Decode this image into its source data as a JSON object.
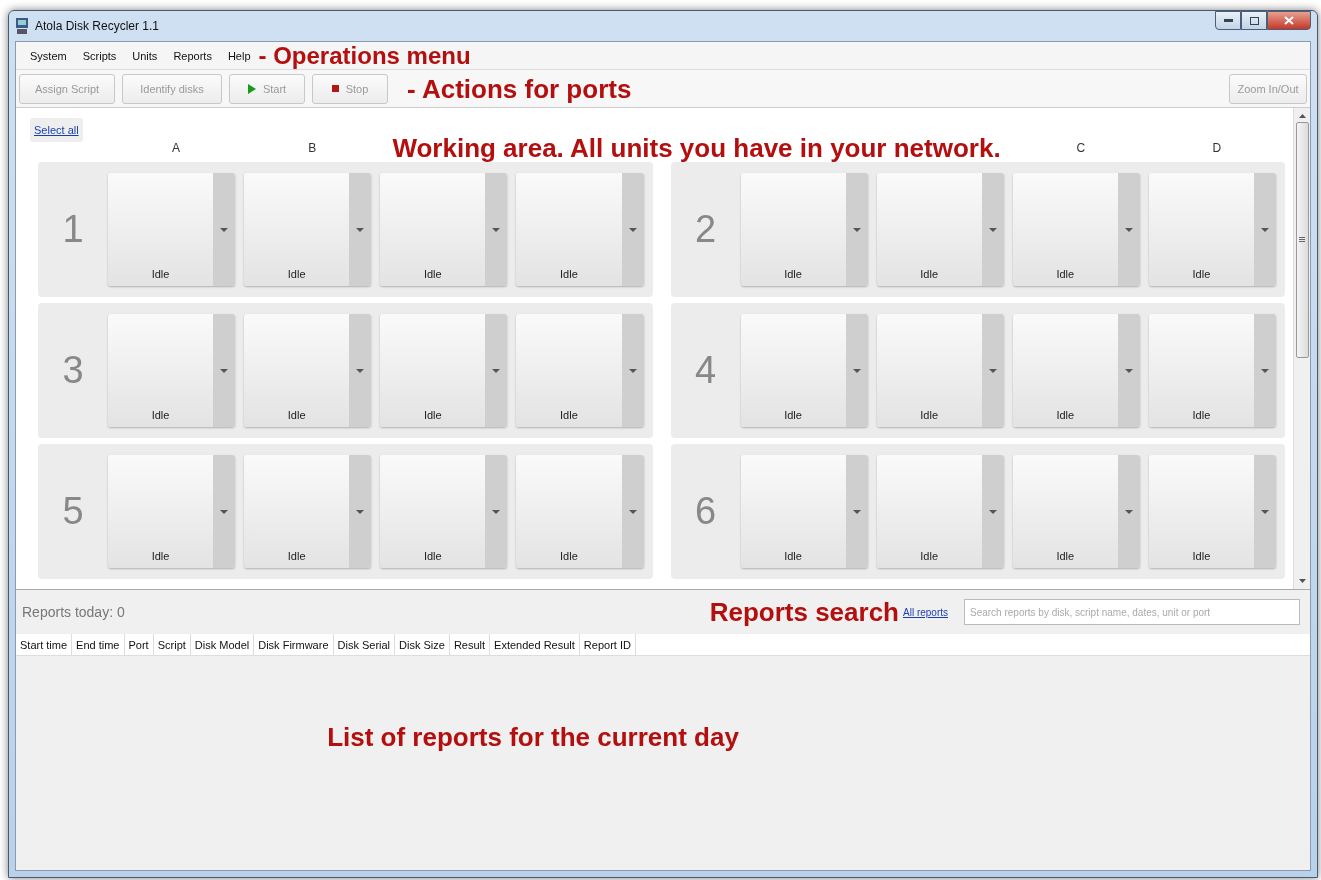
{
  "window": {
    "title": "Atola Disk Recycler 1.1"
  },
  "menu": [
    {
      "label": "System"
    },
    {
      "label": "Scripts"
    },
    {
      "label": "Units"
    },
    {
      "label": "Reports"
    },
    {
      "label": "Help"
    }
  ],
  "menu_annotation": "- Operations menu",
  "toolbar": [
    {
      "label": "Assign Script",
      "kind": "plain",
      "disabled": true
    },
    {
      "label": "Identify disks",
      "kind": "plain",
      "disabled": true
    },
    {
      "label": "Start",
      "kind": "start",
      "disabled": true
    },
    {
      "label": "Stop",
      "kind": "stop",
      "disabled": true
    }
  ],
  "toolbar_annotation": "- Actions for ports",
  "zoom_button": {
    "label": "Zoom In/Out",
    "disabled": true
  },
  "select_all": "Select all",
  "column_headers": {
    "left": [
      "A",
      "B"
    ],
    "right": [
      "C",
      "D"
    ]
  },
  "working_area_annotation": "Working area. All units you have in your network.",
  "units": [
    {
      "number": "1",
      "ports": [
        {
          "status": "Idle"
        },
        {
          "status": "Idle"
        },
        {
          "status": "Idle"
        },
        {
          "status": "Idle"
        }
      ]
    },
    {
      "number": "2",
      "ports": [
        {
          "status": "Idle"
        },
        {
          "status": "Idle"
        },
        {
          "status": "Idle"
        },
        {
          "status": "Idle"
        }
      ]
    },
    {
      "number": "3",
      "ports": [
        {
          "status": "Idle"
        },
        {
          "status": "Idle"
        },
        {
          "status": "Idle"
        },
        {
          "status": "Idle"
        }
      ]
    },
    {
      "number": "4",
      "ports": [
        {
          "status": "Idle"
        },
        {
          "status": "Idle"
        },
        {
          "status": "Idle"
        },
        {
          "status": "Idle"
        }
      ]
    },
    {
      "number": "5",
      "ports": [
        {
          "status": "Idle"
        },
        {
          "status": "Idle"
        },
        {
          "status": "Idle"
        },
        {
          "status": "Idle"
        }
      ]
    },
    {
      "number": "6",
      "ports": [
        {
          "status": "Idle"
        },
        {
          "status": "Idle"
        },
        {
          "status": "Idle"
        },
        {
          "status": "Idle"
        }
      ]
    }
  ],
  "reports": {
    "count_label": "Reports today: 0",
    "search_annotation": "Reports search",
    "all_reports_link": "All reports",
    "search": {
      "placeholder": "Search reports by disk, script name, dates, unit or port"
    }
  },
  "table": {
    "columns": [
      "Start time",
      "End time",
      "Port",
      "Script",
      "Disk Model",
      "Disk Firmware",
      "Disk Serial",
      "Disk Size",
      "Result",
      "Extended Result",
      "Report ID"
    ]
  },
  "list_annotation": "List of reports for the current day"
}
